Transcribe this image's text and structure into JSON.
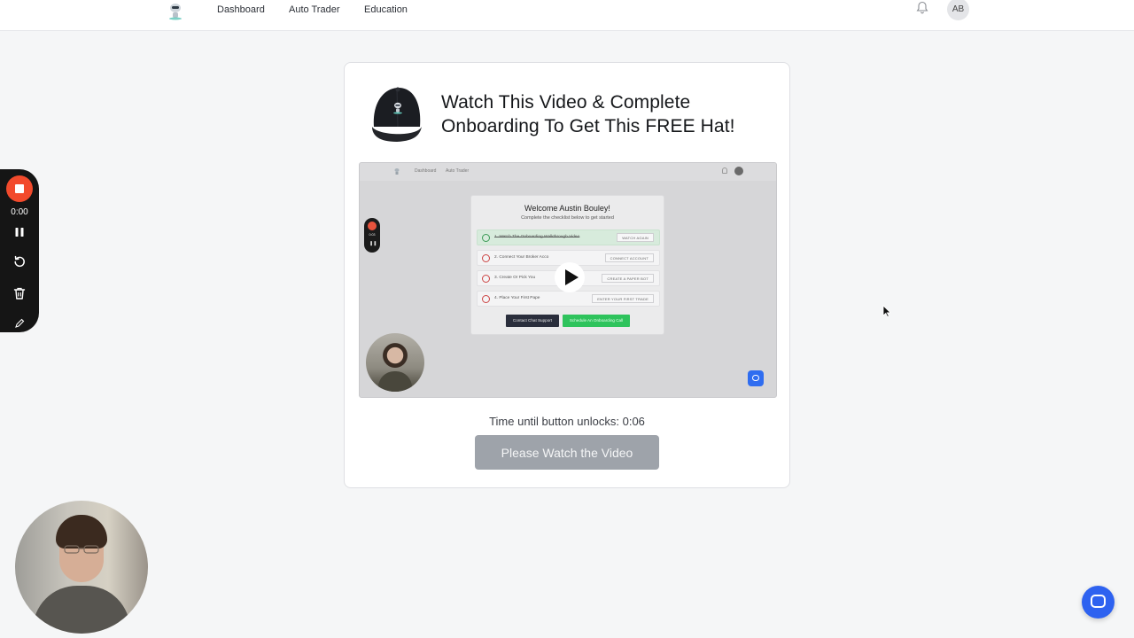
{
  "nav": {
    "links": [
      "Dashboard",
      "Auto Trader",
      "Education"
    ],
    "avatar_initials": "AB"
  },
  "card": {
    "title": "Watch This Video & Complete Onboarding To Get This FREE Hat!",
    "timer_text": "Time until button unlocks: 0:06",
    "button_label": "Please Watch the Video"
  },
  "video": {
    "nav_links": [
      "Dashboard",
      "Auto Trader"
    ],
    "welcome": "Welcome Austin Bouley!",
    "subtitle": "Complete the checklist below to get started",
    "checklist": [
      {
        "label": "1. Watch The Onboarding Walkthrough Video",
        "action": "WATCH AGAIN",
        "done": true
      },
      {
        "label": "2. Connect Your Broker Acco",
        "action": "CONNECT ACCOUNT",
        "done": false
      },
      {
        "label": "3. Create Or Pick You",
        "action": "CREATE A PAPER BOT",
        "done": false
      },
      {
        "label": "4. Place Your First Pape",
        "action": "ENTER YOUR FIRST TRADE",
        "done": false
      }
    ],
    "contact_button": "Contact Chat Support",
    "schedule_button": "Schedule An Onboarding Call",
    "recorder_time": "0:03"
  },
  "recorder": {
    "time": "0:00",
    "stop_color": "#f24a2c"
  },
  "colors": {
    "accent_blue": "#2e62f0",
    "disabled_button": "#9ea3aa"
  },
  "icons": [
    "robot-logo-icon",
    "bell-icon",
    "hat-image",
    "play-icon",
    "stop-icon",
    "pause-icon",
    "restart-icon",
    "trash-icon",
    "chat-icon"
  ]
}
